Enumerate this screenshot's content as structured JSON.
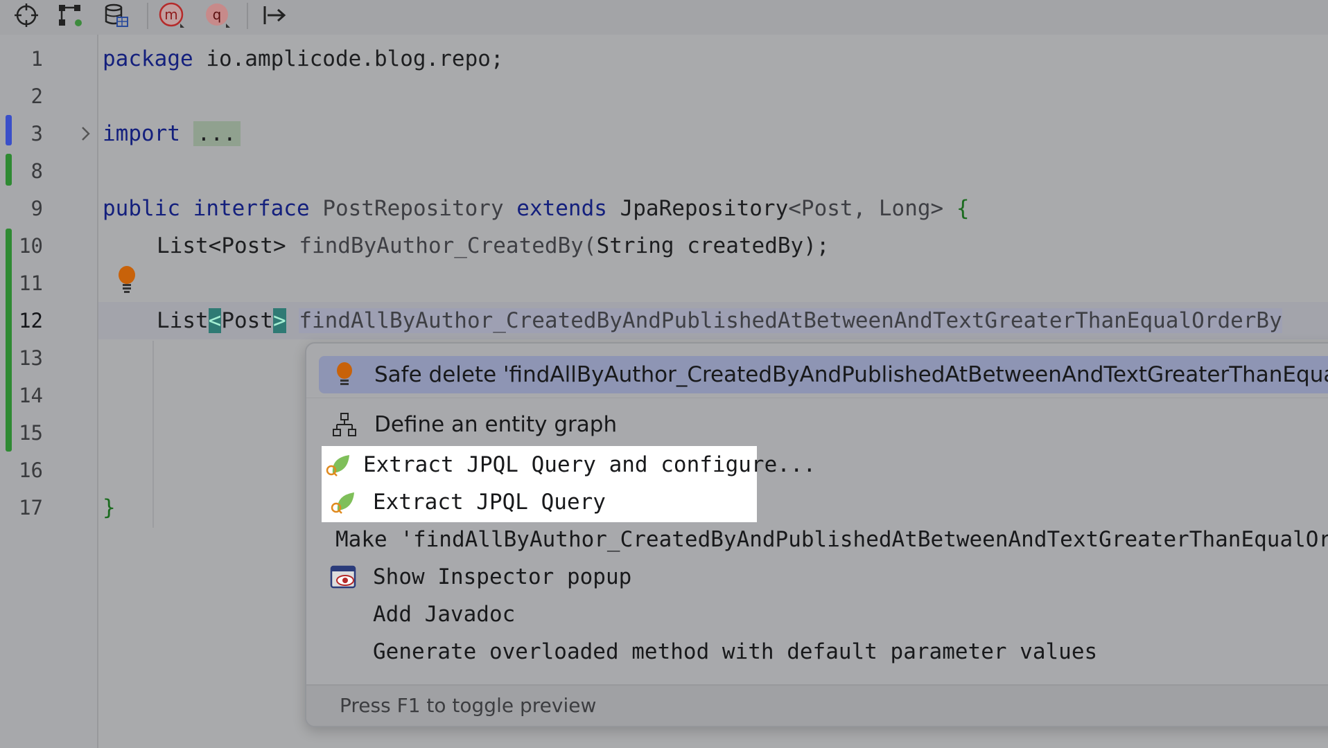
{
  "toolbar": {
    "icons": [
      "crosshair-icon",
      "structure-icon",
      "database-icon",
      "jpa-method-icon",
      "jpa-query-icon",
      "step-into-icon"
    ],
    "m_label": "m",
    "q_label": "q"
  },
  "editor": {
    "lines": [
      {
        "num": "1"
      },
      {
        "num": "2"
      },
      {
        "num": "3"
      },
      {
        "num": "8"
      },
      {
        "num": "9"
      },
      {
        "num": "10"
      },
      {
        "num": "11"
      },
      {
        "num": "12"
      },
      {
        "num": "13"
      },
      {
        "num": "14"
      },
      {
        "num": "15"
      },
      {
        "num": "16"
      },
      {
        "num": "17"
      }
    ],
    "code": {
      "l1_kw": "package",
      "l1_rest": " io.amplicode.blog.repo;",
      "l3_kw": "import",
      "l3_dots": "...",
      "l9_kw1": "public",
      "l9_kw2": "interface",
      "l9_name": "PostRepository",
      "l9_kw3": "extends",
      "l9_type": "JpaRepository",
      "l9_generic": "<Post, Long>",
      "l9_brace": "{",
      "l10_type": "List<Post>",
      "l10_method": " findByAuthor_CreatedBy(",
      "l10_params": "String createdBy",
      "l10_end": ");",
      "l12_type": "List",
      "l12_lt": "<",
      "l12_post": "Post",
      "l12_gt": ">",
      "l12_method": "findAllByAuthor_CreatedByAndPublishedAtBetweenAndTextGreaterThanEqualOrderBy",
      "l17_brace": "}"
    }
  },
  "popup": {
    "items": [
      {
        "label": "Safe delete 'findAllByAuthor_CreatedByAndPublishedAtBetweenAndTextGreaterThanEqua",
        "icon": "bulb-icon"
      },
      {
        "label": "Define an entity graph",
        "icon": "entity-graph-icon"
      },
      {
        "label": "Extract JPQL Query and configure...",
        "icon": "jpql-leaf-icon"
      },
      {
        "label": "Extract JPQL Query",
        "icon": "jpql-leaf-icon"
      },
      {
        "label": "Make 'findAllByAuthor_CreatedByAndPublishedAtBetweenAndTextGreaterThanEqualOrder",
        "icon": ""
      },
      {
        "label": "Show Inspector popup",
        "icon": "inspector-icon"
      },
      {
        "label": "Add Javadoc",
        "icon": ""
      },
      {
        "label": "Generate overloaded method with default parameter values",
        "icon": ""
      }
    ],
    "footer": "Press F1 to toggle preview"
  },
  "colors": {
    "keyword": "#14207d",
    "string_green": "#1b6b1f",
    "selection": "#8e95b4",
    "bulb": "#c8620a"
  }
}
